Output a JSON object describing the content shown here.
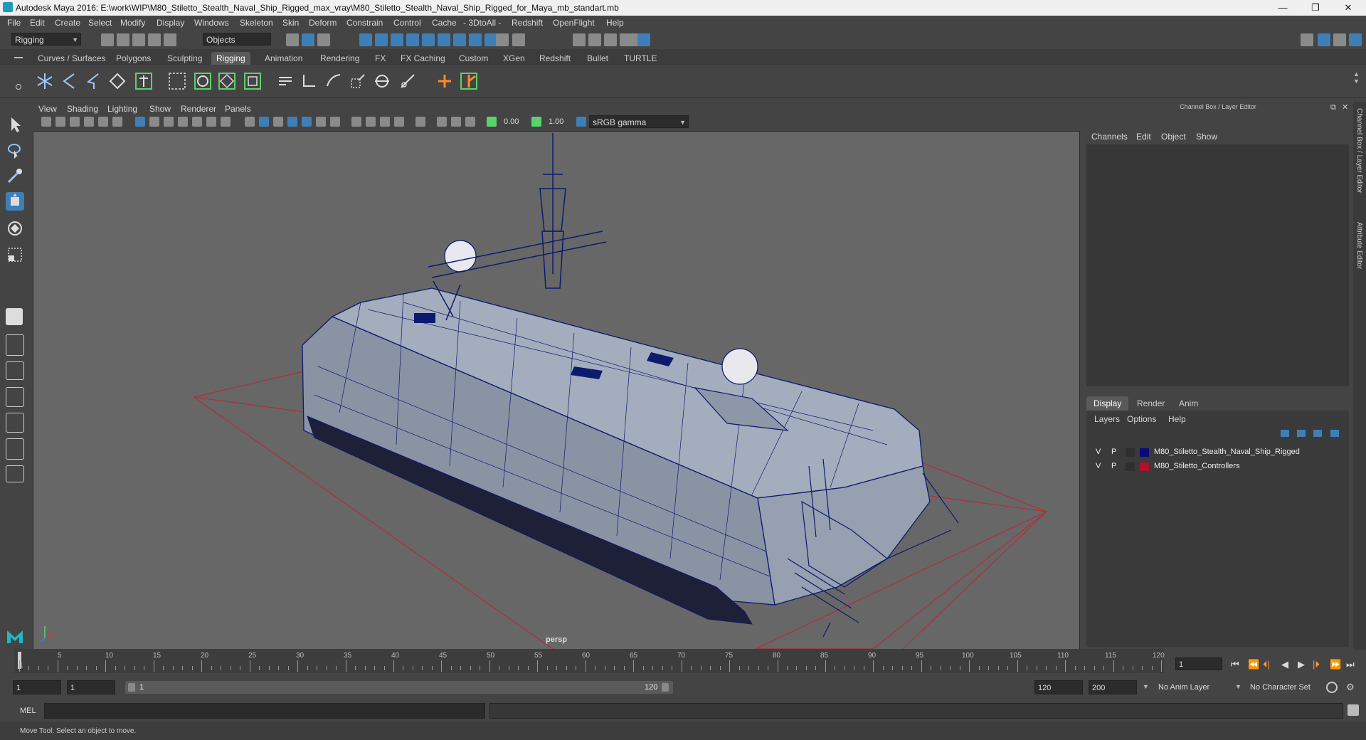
{
  "window": {
    "title": "Autodesk Maya 2016: E:\\work\\WIP\\M80_Stiletto_Stealth_Naval_Ship_Rigged_max_vray\\M80_Stiletto_Stealth_Naval_Ship_Rigged_for_Maya_mb_standart.mb",
    "minimize": "—",
    "restore": "❐",
    "close": "✕"
  },
  "menubar": [
    "File",
    "Edit",
    "Create",
    "Select",
    "Modify",
    "Display",
    "Windows",
    "Skeleton",
    "Skin",
    "Deform",
    "Constrain",
    "Control",
    "Cache",
    "- 3DtoAll -",
    "Redshift",
    "OpenFlight",
    "Help"
  ],
  "statusline": {
    "menuset": "Rigging",
    "selection_mode": "Objects"
  },
  "shelf_tabs": [
    "Curves / Surfaces",
    "Polygons",
    "Sculpting",
    "Rigging",
    "Animation",
    "Rendering",
    "FX",
    "FX Caching",
    "Custom",
    "XGen",
    "Redshift",
    "Bullet",
    "TURTLE"
  ],
  "active_shelf_tab": "Rigging",
  "viewport": {
    "menus": [
      "View",
      "Shading",
      "Lighting",
      "Show",
      "Renderer",
      "Panels"
    ],
    "exposure": "0.00",
    "gamma": "1.00",
    "color_space": "sRGB gamma",
    "camera_label": "persp"
  },
  "channel_box": {
    "title": "Channel Box / Layer Editor",
    "menus": [
      "Channels",
      "Edit",
      "Object",
      "Show"
    ]
  },
  "layer_editor": {
    "tabs": [
      "Display",
      "Render",
      "Anim"
    ],
    "active_tab": "Display",
    "menus": [
      "Layers",
      "Options",
      "Help"
    ],
    "layers": [
      {
        "v": "V",
        "p": "P",
        "name": "M80_Stiletto_Stealth_Naval_Ship_Rigged",
        "color": "#0a0a7a"
      },
      {
        "v": "V",
        "p": "P",
        "name": "M80_Stiletto_Controllers",
        "color": "#b0102a"
      }
    ]
  },
  "side_tabs": [
    "Channel Box / Layer Editor",
    "Attribute Editor"
  ],
  "timeslider": {
    "labels": [
      "1",
      "5",
      "10",
      "15",
      "20",
      "25",
      "30",
      "35",
      "40",
      "45",
      "50",
      "55",
      "60",
      "65",
      "70",
      "75",
      "80",
      "85",
      "90",
      "95",
      "100",
      "105",
      "110",
      "115",
      "120"
    ],
    "current_frame": "1"
  },
  "playback": {
    "buttons": [
      "⏮",
      "⏪",
      "⏴|",
      "◀",
      "▶",
      "|⏵",
      "⏩",
      "⏭"
    ]
  },
  "range": {
    "start": "1",
    "playback_start": "1",
    "slider_start": "1",
    "slider_end": "120",
    "playback_end": "120",
    "end": "200",
    "anim_layer": "No Anim Layer",
    "character_set": "No Character Set"
  },
  "command_line": {
    "label": "MEL"
  },
  "help_line": {
    "text": "Move Tool: Select an object to move."
  },
  "colors": {
    "wire": "#0c1b6e",
    "grid_line": "#b32d3c",
    "hull": "#a4adbd",
    "accent_blue": "#3f7fb8"
  }
}
